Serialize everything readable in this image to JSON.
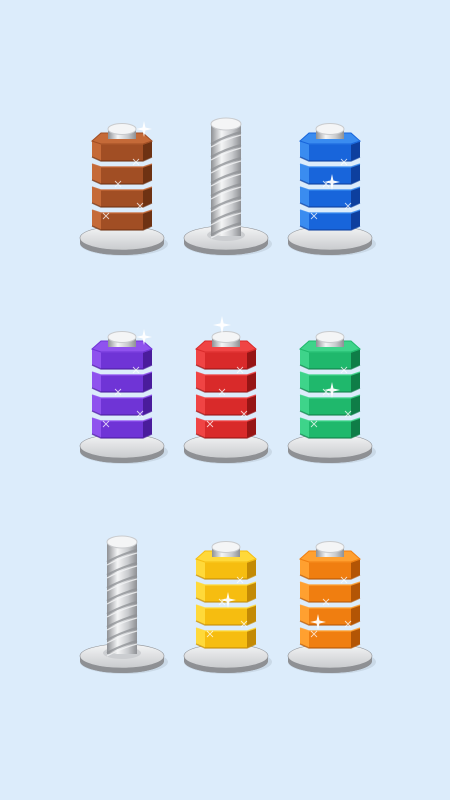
{
  "colors": {
    "background": "#dcecfb",
    "metal_light": "#f4f5f6",
    "metal_mid": "#c9cbce",
    "metal_dark": "#8e9094",
    "sparkle": "#ffffff"
  },
  "nut_colors": {
    "brown": {
      "light": "#c56a38",
      "mid": "#a14e24",
      "dark": "#6e3213"
    },
    "blue": {
      "light": "#3a8cf0",
      "mid": "#1865db",
      "dark": "#0d3f9e"
    },
    "purple": {
      "light": "#8f52ee",
      "mid": "#6f34d6",
      "dark": "#4a1c9c"
    },
    "red": {
      "light": "#f04444",
      "mid": "#d92a2a",
      "dark": "#961515"
    },
    "green": {
      "light": "#3ed48a",
      "mid": "#1fb86c",
      "dark": "#0f7d47"
    },
    "yellow": {
      "light": "#ffd93a",
      "mid": "#f6bd10",
      "dark": "#c38a05"
    },
    "orange": {
      "light": "#ffa030",
      "mid": "#f07e10",
      "dark": "#b35505"
    }
  },
  "board": {
    "rows": [
      {
        "bolts": [
          {
            "nuts": [
              "brown",
              "brown",
              "brown",
              "brown"
            ],
            "complete": true,
            "sparkle": "top-right"
          },
          {
            "nuts": [],
            "complete": false,
            "sparkle": "none"
          },
          {
            "nuts": [
              "blue",
              "blue",
              "blue",
              "blue"
            ],
            "complete": true,
            "sparkle": "middle"
          }
        ]
      },
      {
        "bolts": [
          {
            "nuts": [
              "purple",
              "purple",
              "purple",
              "purple"
            ],
            "complete": true,
            "sparkle": "top-right"
          },
          {
            "nuts": [
              "red",
              "red",
              "red",
              "red"
            ],
            "complete": true,
            "sparkle": "top"
          },
          {
            "nuts": [
              "green",
              "green",
              "green",
              "green"
            ],
            "complete": true,
            "sparkle": "middle"
          }
        ]
      },
      {
        "bolts": [
          {
            "nuts": [],
            "complete": false,
            "sparkle": "none"
          },
          {
            "nuts": [
              "yellow",
              "yellow",
              "yellow",
              "yellow"
            ],
            "complete": true,
            "sparkle": "middle"
          },
          {
            "nuts": [
              "orange",
              "orange",
              "orange",
              "orange"
            ],
            "complete": true,
            "sparkle": "lower-left"
          }
        ]
      }
    ]
  }
}
